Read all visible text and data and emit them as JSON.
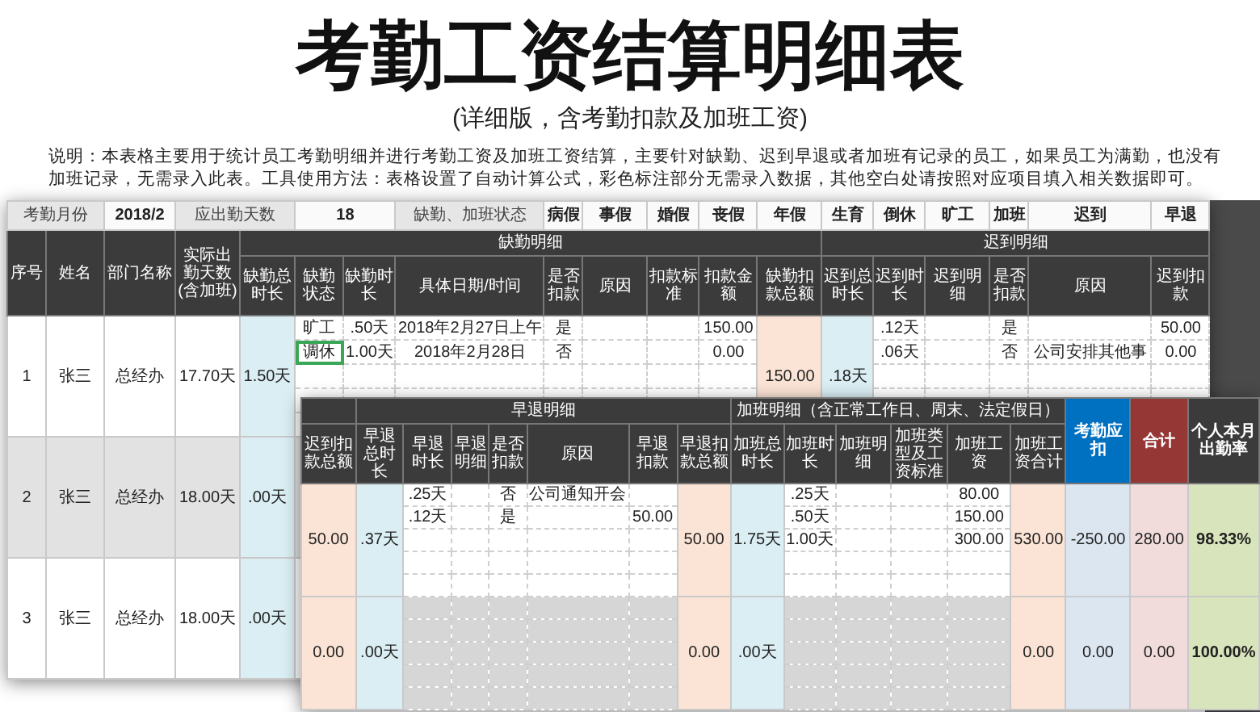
{
  "title": "考勤工资结算明细表",
  "subtitle": "(详细版，含考勤扣款及加班工资)",
  "description": "说明：本表格主要用于统计员工考勤明细并进行考勤工资及加班工资结算，主要针对缺勤、迟到早退或者加班有记录的员工，如果员工为满勤，也没有加班记录，无需录入此表。工具使用方法：表格设置了自动计算公式，彩色标注部分无需录入数据，其他空白处请按照对应项目填入相关数据即可。",
  "sheet_back": {
    "info_row": [
      {
        "text": "考勤月份",
        "kind": "label"
      },
      {
        "text": "2018/2",
        "kind": "value"
      },
      {
        "text": "应出勤天数",
        "kind": "label"
      },
      {
        "text": "18",
        "kind": "value"
      },
      {
        "text": "缺勤、加班状态",
        "kind": "label"
      },
      {
        "text": "病假",
        "kind": "value"
      },
      {
        "text": "事假",
        "kind": "value"
      },
      {
        "text": "婚假",
        "kind": "value"
      },
      {
        "text": "丧假",
        "kind": "value"
      },
      {
        "text": "年假",
        "kind": "value"
      },
      {
        "text": "生育",
        "kind": "value"
      },
      {
        "text": "倒休",
        "kind": "value"
      },
      {
        "text": "旷工",
        "kind": "value"
      },
      {
        "text": "加班",
        "kind": "value"
      },
      {
        "text": "迟到",
        "kind": "value"
      },
      {
        "text": "早退",
        "kind": "value"
      }
    ],
    "group_headers": [
      "缺勤明细",
      "迟到明细"
    ],
    "columns": [
      "序号",
      "姓名",
      "部门名称",
      "实际出勤天数(含加班)",
      "缺勤总时长",
      "缺勤状态",
      "缺勤时长",
      "具体日期/时间",
      "是否扣款",
      "原因",
      "扣款标准",
      "扣款金额",
      "缺勤扣款总额",
      "迟到总时长",
      "迟到时长",
      "迟到明细",
      "是否扣款",
      "原因",
      "迟到扣款"
    ],
    "rows": [
      {
        "no": "1",
        "name": "张三",
        "dept": "总经办",
        "actual_days": "17.70天",
        "absence_total": "1.50天",
        "absence_deduction_total": "150.00",
        "late_total": ".18天",
        "shaded": false,
        "details": [
          {
            "status": "旷工",
            "hours": ".50天",
            "date": "2018年2月27日上午",
            "deduct": "是",
            "amount": "150.00",
            "late_hours": ".12天",
            "late_deduct": "是",
            "late_amount": "50.00",
            "selected": false
          },
          {
            "status": "调休",
            "hours": "1.00天",
            "date": "2018年2月28日",
            "deduct": "否",
            "amount": "0.00",
            "late_hours": ".06天",
            "late_deduct": "否",
            "late_reason": "公司安排其他事",
            "late_amount": "0.00",
            "selected": true
          }
        ]
      },
      {
        "no": "2",
        "name": "张三",
        "dept": "总经办",
        "actual_days": "18.00天",
        "absence_total": ".00天",
        "shaded": true
      },
      {
        "no": "3",
        "name": "张三",
        "dept": "总经办",
        "actual_days": "18.00天",
        "absence_total": ".00天",
        "shaded": false
      }
    ]
  },
  "sheet_front": {
    "group_headers": [
      "早退明细",
      "加班明细（含正常工作日、周末、法定假日）"
    ],
    "columns": [
      "迟到扣款总额",
      "早退总时长",
      "早退时长",
      "早退明细",
      "是否扣款",
      "原因",
      "早退扣款",
      "早退扣款总额",
      "加班总时长",
      "加班时长",
      "加班明细",
      "加班类型及工资标准",
      "加班工资",
      "加班工资合计"
    ],
    "summary_columns": [
      {
        "label": "考勤应扣",
        "color": "#0070c0"
      },
      {
        "label": "合计",
        "color": "#953735"
      },
      {
        "label": "个人本月出勤率",
        "color": "#3b3b3b"
      }
    ],
    "rows": [
      {
        "late_deduction_total": "50.00",
        "early_total": ".37天",
        "early_deduction_total": "50.00",
        "overtime_total": "1.75天",
        "overtime_pay_total": "530.00",
        "attendance_deduction": "-250.00",
        "sum": "280.00",
        "attendance_rate": "98.33%",
        "shaded": false,
        "details": [
          {
            "early_hours": ".25天",
            "early_deduct": "否",
            "early_reason": "公司通知开会",
            "ot_hours": ".25天",
            "ot_pay": "80.00"
          },
          {
            "early_hours": ".12天",
            "early_deduct": "是",
            "early_amount": "50.00",
            "ot_hours": ".50天",
            "ot_pay": "150.00"
          },
          {
            "ot_hours": "1.00天",
            "ot_pay": "300.00"
          }
        ]
      },
      {
        "late_deduction_total": "0.00",
        "early_total": ".00天",
        "early_deduction_total": "0.00",
        "overtime_total": ".00天",
        "overtime_pay_total": "0.00",
        "attendance_deduction": "0.00",
        "sum": "0.00",
        "attendance_rate": "100.00%",
        "shaded": true
      }
    ]
  }
}
